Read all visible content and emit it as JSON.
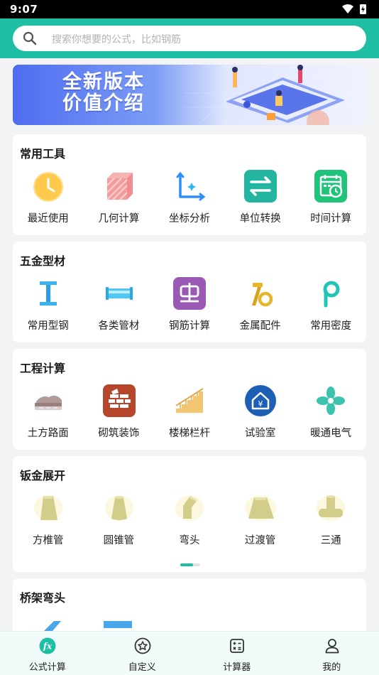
{
  "status_bar": {
    "time": "9:07"
  },
  "search": {
    "placeholder": "搜索你想要的公式，比如钢筋"
  },
  "banner": {
    "line1": "全新版本",
    "line2": "价值介绍"
  },
  "sections": [
    {
      "title": "常用工具",
      "items": [
        {
          "label": "最近使用",
          "icon": "clock-icon"
        },
        {
          "label": "几何计算",
          "icon": "cube-icon"
        },
        {
          "label": "坐标分析",
          "icon": "axis-icon"
        },
        {
          "label": "单位转换",
          "icon": "swap-icon"
        },
        {
          "label": "时间计算",
          "icon": "calendar-icon"
        }
      ]
    },
    {
      "title": "五金型材",
      "items": [
        {
          "label": "常用型钢",
          "icon": "i-beam-icon"
        },
        {
          "label": "各类管材",
          "icon": "pipe-icon"
        },
        {
          "label": "钢筋计算",
          "icon": "rebar-icon"
        },
        {
          "label": "金属配件",
          "icon": "fitting-icon"
        },
        {
          "label": "常用密度",
          "icon": "density-icon"
        }
      ]
    },
    {
      "title": "工程计算",
      "items": [
        {
          "label": "土方路面",
          "icon": "earthwork-icon"
        },
        {
          "label": "砌筑装饰",
          "icon": "brick-icon"
        },
        {
          "label": "楼梯栏杆",
          "icon": "stairs-icon"
        },
        {
          "label": "试验室",
          "icon": "lab-icon"
        },
        {
          "label": "暖通电气",
          "icon": "fan-icon"
        }
      ]
    },
    {
      "title": "钣金展开",
      "items": [
        {
          "label": "方椎管",
          "icon": "square-pyramid-icon"
        },
        {
          "label": "圆锥管",
          "icon": "cone-icon"
        },
        {
          "label": "弯头",
          "icon": "elbow-icon"
        },
        {
          "label": "过渡管",
          "icon": "transition-icon"
        },
        {
          "label": "三通",
          "icon": "tee-icon"
        }
      ]
    },
    {
      "title": "桥架弯头",
      "items": []
    }
  ],
  "tabs": [
    {
      "label": "公式计算",
      "icon": "fx-icon",
      "active": true
    },
    {
      "label": "自定义",
      "icon": "star-icon",
      "active": false
    },
    {
      "label": "计算器",
      "icon": "calculator-icon",
      "active": false
    },
    {
      "label": "我的",
      "icon": "user-icon",
      "active": false
    }
  ],
  "colors": {
    "accent": "#1fbfa6",
    "tab_active": "#1fbfa6",
    "background": "#f2f3f5"
  }
}
